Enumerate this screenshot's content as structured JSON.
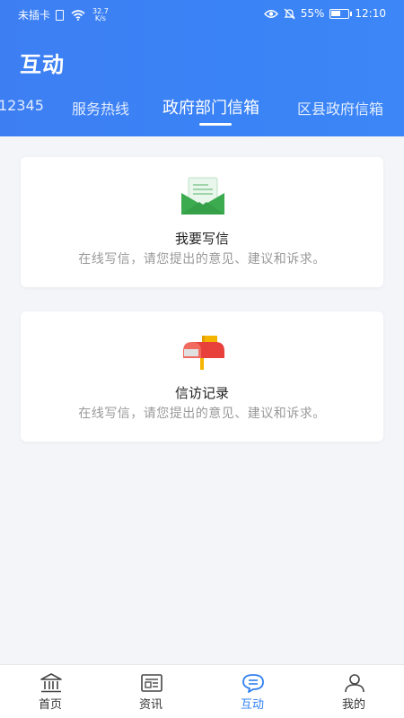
{
  "status_bar": {
    "carrier": "未插卡",
    "net_speed_value": "32.7",
    "net_speed_unit": "K/s",
    "battery": "55%",
    "time": "12:10"
  },
  "header": {
    "title": "互动"
  },
  "tabs": [
    {
      "label": "12345"
    },
    {
      "label": "服务热线"
    },
    {
      "label": "政府部门信箱",
      "active": true
    },
    {
      "label": "区县政府信箱"
    }
  ],
  "cards": [
    {
      "title": "我要写信",
      "description": "在线写信，请您提出的意见、建议和诉求。",
      "icon": "envelope-icon"
    },
    {
      "title": "信访记录",
      "description": "在线写信，请您提出的意见、建议和诉求。",
      "icon": "mailbox-icon"
    }
  ],
  "bottom_nav": [
    {
      "label": "首页",
      "icon": "bank-icon"
    },
    {
      "label": "资讯",
      "icon": "news-icon"
    },
    {
      "label": "互动",
      "icon": "chat-icon",
      "active": true
    },
    {
      "label": "我的",
      "icon": "user-icon"
    }
  ],
  "colors": {
    "header_blue": "#3a83f6",
    "accent": "#2f7ff1",
    "envelope_green": "#3cab4f",
    "mailbox_red": "#e8413b"
  }
}
